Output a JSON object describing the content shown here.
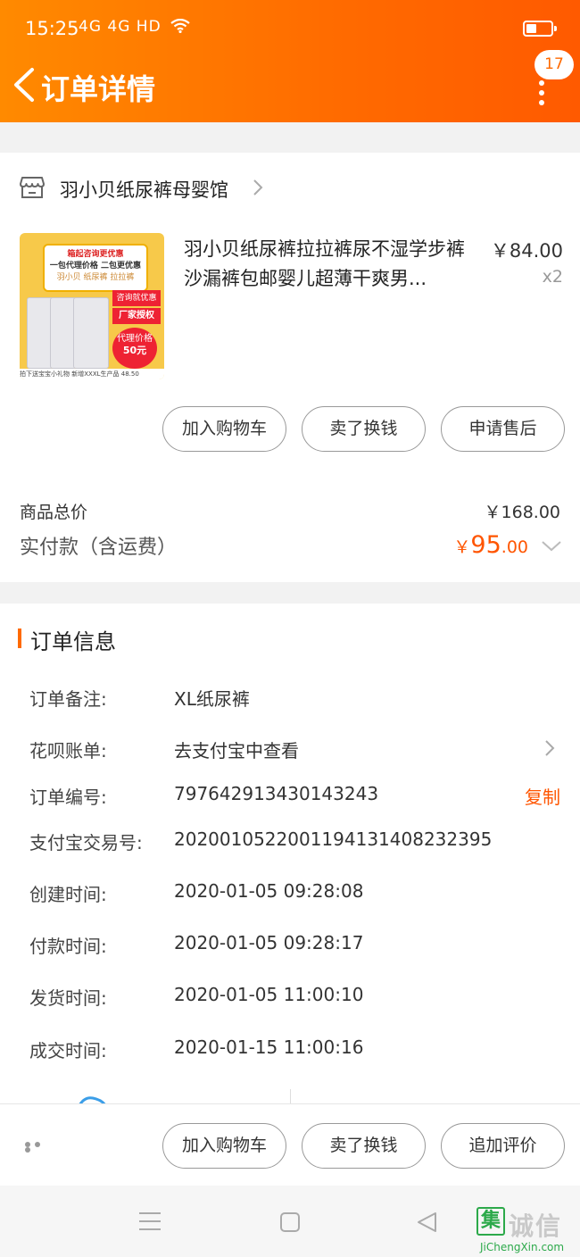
{
  "status_bar": {
    "time": "15:25",
    "network": "4G 4G HD"
  },
  "header": {
    "title": "订单详情",
    "badge_count": "17"
  },
  "shop": {
    "name": "羽小贝纸尿裤母婴馆"
  },
  "product": {
    "title": "羽小贝纸尿裤拉拉裤尿不湿学步裤沙漏裤包邮婴儿超薄干爽男...",
    "price": "￥84.00",
    "quantity": "x2",
    "image": {
      "headline": "箱起咨询更优惠",
      "line2": "一包代理价格 二包更优惠",
      "line3": "羽小贝  纸尿裤  拉拉裤",
      "tag1": "咨询就优惠",
      "tag2": "厂家授权",
      "price_note": "代理价格",
      "price": "50元",
      "footer": "拍下送宝宝小礼物  新增XXXL生产品  48.50"
    }
  },
  "product_actions": {
    "add_cart": "加入购物车",
    "resell": "卖了换钱",
    "after_sale": "申请售后"
  },
  "totals": {
    "goods_total_label": "商品总价",
    "goods_total_value": "￥168.00",
    "paid_label": "实付款（含运费）",
    "paid_currency": "￥",
    "paid_integer": "95",
    "paid_decimal": ".00"
  },
  "order_info": {
    "title": "订单信息",
    "rows": [
      {
        "label": "订单备注:",
        "value": "XL纸尿裤"
      },
      {
        "label": "花呗账单:",
        "value": "去支付宝中查看"
      },
      {
        "label": "订单编号:",
        "value": "797642913430143243",
        "action": "复制"
      },
      {
        "label": "支付宝交易号:",
        "value": "2020010522001194131408232395"
      },
      {
        "label": "创建时间:",
        "value": "2020-01-05 09:28:08"
      },
      {
        "label": "付款时间:",
        "value": "2020-01-05 09:28:17"
      },
      {
        "label": "发货时间:",
        "value": "2020-01-05 11:00:10"
      },
      {
        "label": "成交时间:",
        "value": "2020-01-15 11:00:16"
      }
    ]
  },
  "bottom_actions": {
    "add_cart": "加入购物车",
    "resell": "卖了换钱",
    "add_review": "追加评价"
  },
  "watermark": {
    "mark": "集",
    "chars": "诚信",
    "url": "JiChengXin.com"
  },
  "colors": {
    "accent": "#ff6a00",
    "price": "#ff5500",
    "header_start": "#ff8a00",
    "header_end": "#ff5a00"
  }
}
